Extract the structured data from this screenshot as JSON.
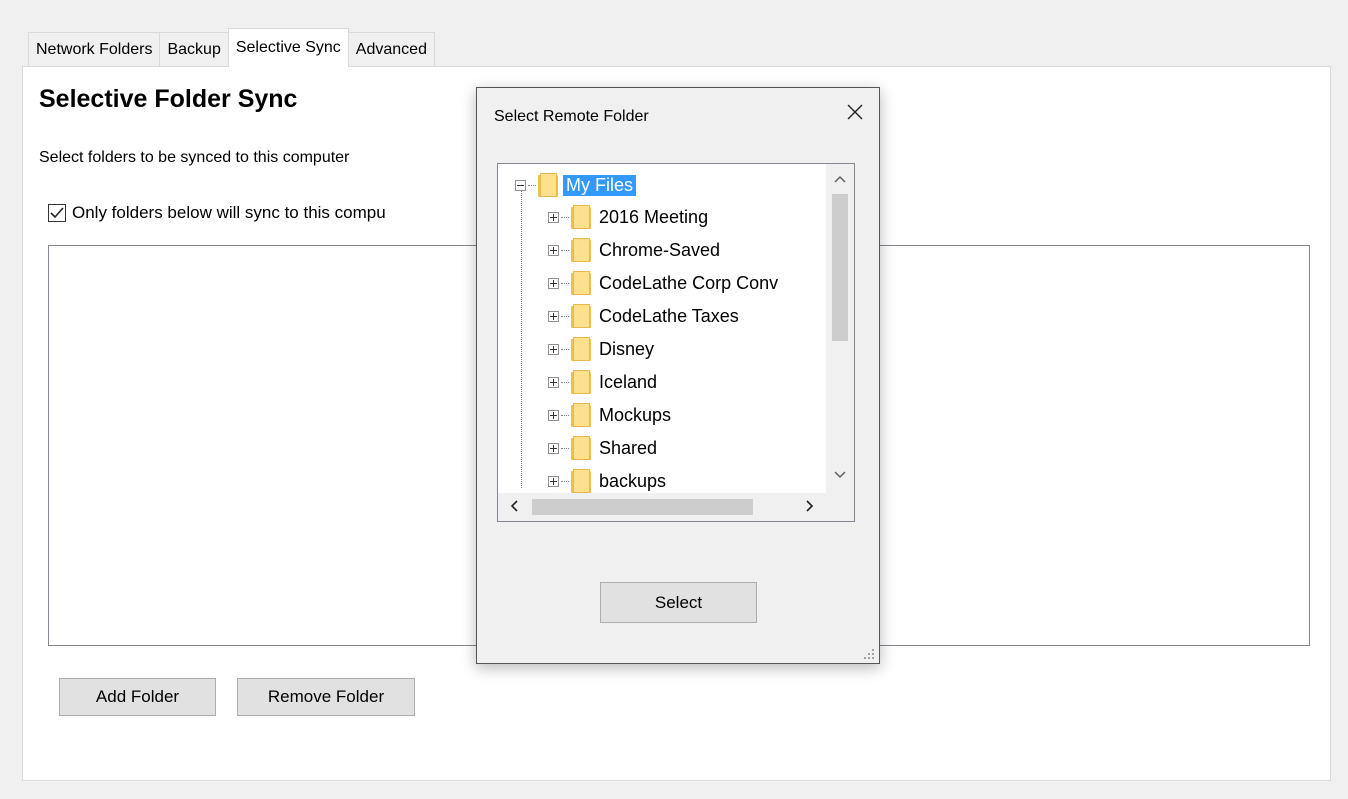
{
  "tabs": [
    {
      "label": "Network Folders",
      "active": false
    },
    {
      "label": "Backup",
      "active": false
    },
    {
      "label": "Selective Sync",
      "active": true
    },
    {
      "label": "Advanced",
      "active": false
    }
  ],
  "panel": {
    "title": "Selective Folder Sync",
    "subtitle": "Select folders to be synced to this computer",
    "checkbox_label": "Only folders below will sync to this compu",
    "checkbox_checked": true,
    "add_folder_label": "Add Folder",
    "remove_folder_label": "Remove Folder"
  },
  "dialog": {
    "title": "Select Remote Folder",
    "root": "My Files",
    "items": [
      "2016 Meeting",
      "Chrome-Saved",
      "CodeLathe Corp Conv",
      "CodeLathe Taxes",
      "Disney",
      "Iceland",
      "Mockups",
      "Shared",
      "backups"
    ],
    "select_label": "Select"
  },
  "colors": {
    "selection": "#3399ff",
    "folder": "#ffe08c",
    "button": "#e1e1e1"
  }
}
